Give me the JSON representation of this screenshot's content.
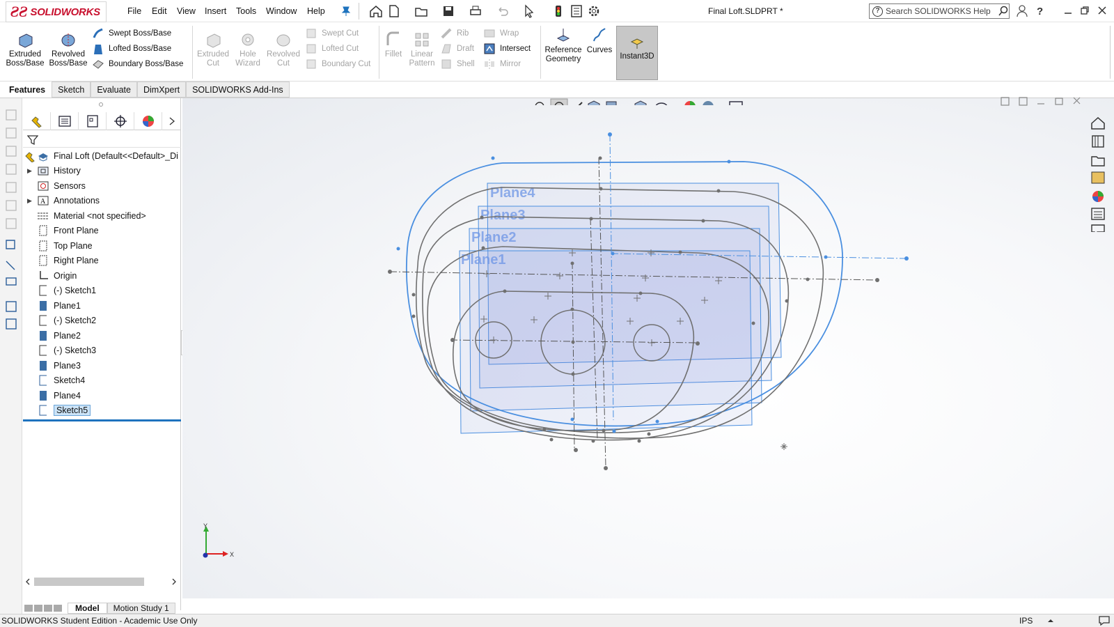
{
  "app": {
    "brand": "SOLIDWORKS",
    "doc_title": "Final Loft.SLDPRT *"
  },
  "menu": [
    "File",
    "Edit",
    "View",
    "Insert",
    "Tools",
    "Window",
    "Help"
  ],
  "search": {
    "placeholder": "Search SOLIDWORKS Help"
  },
  "ribbon": {
    "extruded": "Extruded Boss/Base",
    "revolved": "Revolved Boss/Base",
    "swept": "Swept Boss/Base",
    "lofted": "Lofted Boss/Base",
    "boundary": "Boundary Boss/Base",
    "extruded_cut": "Extruded Cut",
    "hole_wizard": "Hole Wizard",
    "revolved_cut": "Revolved Cut",
    "swept_cut": "Swept Cut",
    "lofted_cut": "Lofted Cut",
    "boundary_cut": "Boundary Cut",
    "fillet": "Fillet",
    "linear_pattern": "Linear Pattern",
    "rib": "Rib",
    "draft": "Draft",
    "shell": "Shell",
    "wrap": "Wrap",
    "intersect": "Intersect",
    "mirror": "Mirror",
    "ref_geometry": "Reference Geometry",
    "curves": "Curves",
    "instant3d": "Instant3D"
  },
  "tabs": [
    "Features",
    "Sketch",
    "Evaluate",
    "DimXpert",
    "SOLIDWORKS Add-Ins"
  ],
  "tree": {
    "root": "Final Loft  (Default<<Default>_Di",
    "items": [
      "History",
      "Sensors",
      "Annotations",
      "Material <not specified>",
      "Front Plane",
      "Top Plane",
      "Right Plane",
      "Origin",
      "(-) Sketch1",
      "Plane1",
      "(-) Sketch2",
      "Plane2",
      "(-) Sketch3",
      "Plane3",
      "Sketch4",
      "Plane4",
      "Sketch5"
    ]
  },
  "planes": [
    "Plane4",
    "Plane3",
    "Plane2",
    "Plane1"
  ],
  "triad": {
    "x": "X",
    "y": "Y"
  },
  "bottom_tabs": [
    "Model",
    "Motion Study 1"
  ],
  "status": {
    "left": "SOLIDWORKS Student Edition - Academic Use Only",
    "units": "IPS"
  },
  "colors": {
    "accent": "#1e73be",
    "sketch_blue": "#4a8fe0",
    "brand_red": "#c8102e"
  }
}
